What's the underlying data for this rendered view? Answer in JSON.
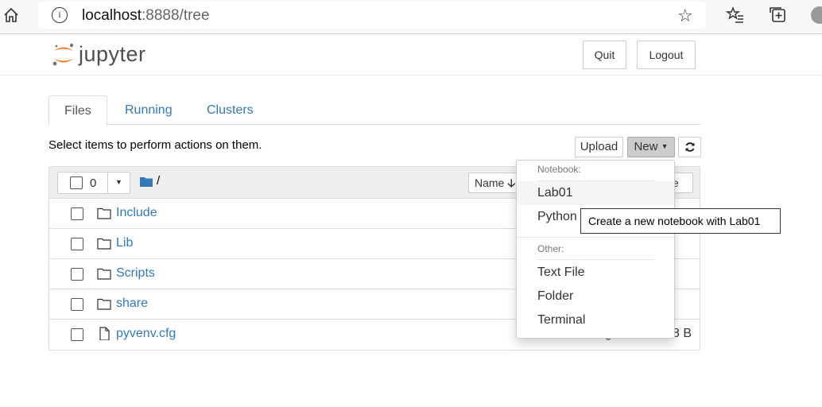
{
  "browser": {
    "url_host": "localhost",
    "url_rest": ":8888/tree",
    "icons": [
      "home-icon",
      "info-icon",
      "star-icon",
      "favorites-icon",
      "collections-icon",
      "profile-icon"
    ]
  },
  "header": {
    "logo_text": "jupyter",
    "quit_label": "Quit",
    "logout_label": "Logout",
    "logo_colors": {
      "orange": "#f37726",
      "grey": "#767677"
    }
  },
  "tabs": [
    {
      "label": "Files",
      "active": true
    },
    {
      "label": "Running",
      "active": false
    },
    {
      "label": "Clusters",
      "active": false
    }
  ],
  "toolbar": {
    "instructions": "Select items to perform actions on them.",
    "upload_label": "Upload",
    "new_label": "New",
    "refresh_icon": "refresh-icon"
  },
  "list_header": {
    "selected_count": "0",
    "root_path": "/",
    "name_sort_label": "Name",
    "size_sort_label": "ze"
  },
  "files": [
    {
      "name": "Include",
      "type": "folder",
      "modified": "",
      "size": ""
    },
    {
      "name": "Lib",
      "type": "folder",
      "modified": "",
      "size": ""
    },
    {
      "name": "Scripts",
      "type": "folder",
      "modified": "",
      "size": ""
    },
    {
      "name": "share",
      "type": "folder",
      "modified": "",
      "size": ""
    },
    {
      "name": "pyvenv.cfg",
      "type": "file",
      "modified": "7 minutes ago",
      "size": "78 B"
    }
  ],
  "new_menu": {
    "notebook_header": "Notebook:",
    "notebook_items": [
      "Lab01",
      "Python"
    ],
    "other_header": "Other:",
    "other_items": [
      "Text File",
      "Folder",
      "Terminal"
    ]
  },
  "tooltip": "Create a new notebook with Lab01",
  "colors": {
    "link": "#337ab7",
    "new_button_bg": "#cccccc"
  }
}
